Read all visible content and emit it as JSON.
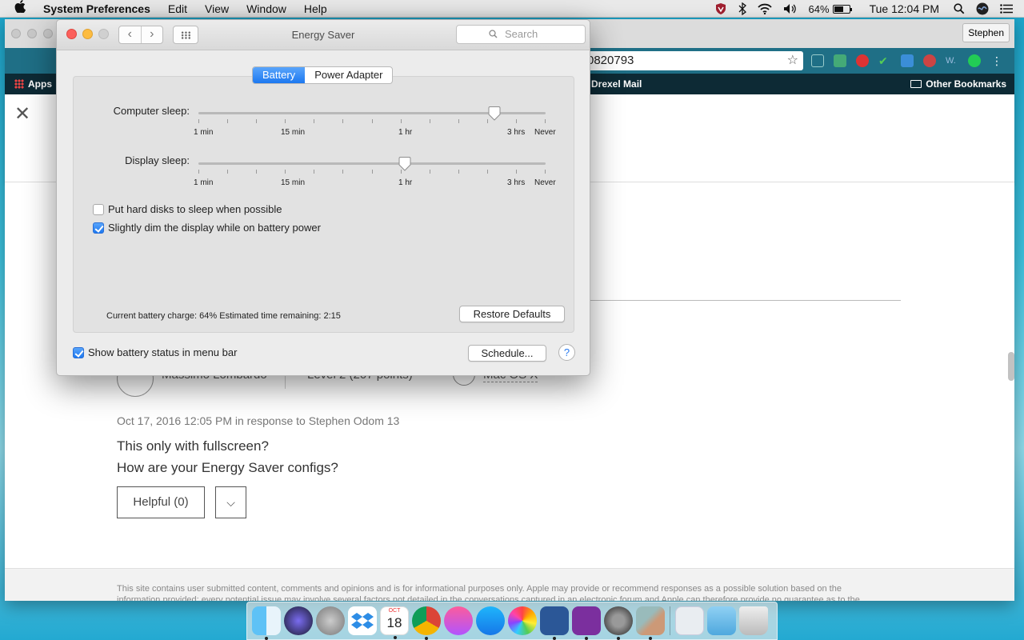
{
  "menubar": {
    "app_name": "System Preferences",
    "menus": [
      "Edit",
      "View",
      "Window",
      "Help"
    ],
    "battery_percent": "64%",
    "battery_level": 0.64,
    "clock": "Tue 12:04 PM"
  },
  "browser": {
    "profile_name": "Stephen",
    "url_fragment": "0820793",
    "bookmarks": {
      "apps": "Apps",
      "drexel": "Drexel Mail",
      "other": "Other Bookmarks"
    },
    "post": {
      "author": "Massimo Lombardo",
      "level": "Level 2  (207 points)",
      "os": "Mac OS X",
      "date": "Oct 17, 2016 12:05 PM in response to Stephen Odom 13",
      "line1": "This only with fullscreen?",
      "line2": "How are your Energy Saver configs?",
      "helpful_label": "Helpful (0)",
      "more_label": "⌵"
    },
    "footer": "This site contains user submitted content, comments and opinions and is for informational purposes only. Apple may provide or recommend responses as a possible solution based on the information provided; every potential issue may involve several factors not detailed in the conversations captured in an electronic forum and Apple can therefore provide no guarantee as to the"
  },
  "prefs_window": {
    "title": "Energy Saver",
    "search_placeholder": "Search",
    "tabs": [
      "Battery",
      "Power Adapter"
    ],
    "active_tab": "Battery",
    "computer_sleep": {
      "label": "Computer sleep:",
      "value": "3 hrs",
      "tick_labels": [
        "1 min",
        "15 min",
        "1 hr",
        "3 hrs",
        "Never"
      ]
    },
    "display_sleep": {
      "label": "Display sleep:",
      "value": "1 hr",
      "tick_labels": [
        "1 min",
        "15 min",
        "1 hr",
        "3 hrs",
        "Never"
      ]
    },
    "checkboxes": [
      {
        "label": "Put hard disks to sleep when possible",
        "checked": false
      },
      {
        "label": "Slightly dim the display while on battery power",
        "checked": true
      }
    ],
    "status": "Current battery charge: 64%  Estimated time remaining: 2:15",
    "restore_defaults": "Restore Defaults",
    "show_battery_status": {
      "label": "Show battery status in menu bar",
      "checked": true
    },
    "schedule_button": "Schedule...",
    "help_button": "?"
  },
  "dock": {
    "calendar_month": "OCT",
    "calendar_day": "18",
    "apps": [
      "Finder",
      "Siri",
      "Launchpad",
      "Dropbox",
      "Calendar",
      "Chrome",
      "iTunes",
      "App Store",
      "Photos",
      "Word",
      "OneNote",
      "System Preferences",
      "Preview",
      "Downloads",
      "Folder",
      "Trash"
    ]
  },
  "colors": {
    "accent": "#1c78f0",
    "close": "#fc605c",
    "minimize": "#fdbc40",
    "browser_toolbar": "#1f6f86"
  }
}
